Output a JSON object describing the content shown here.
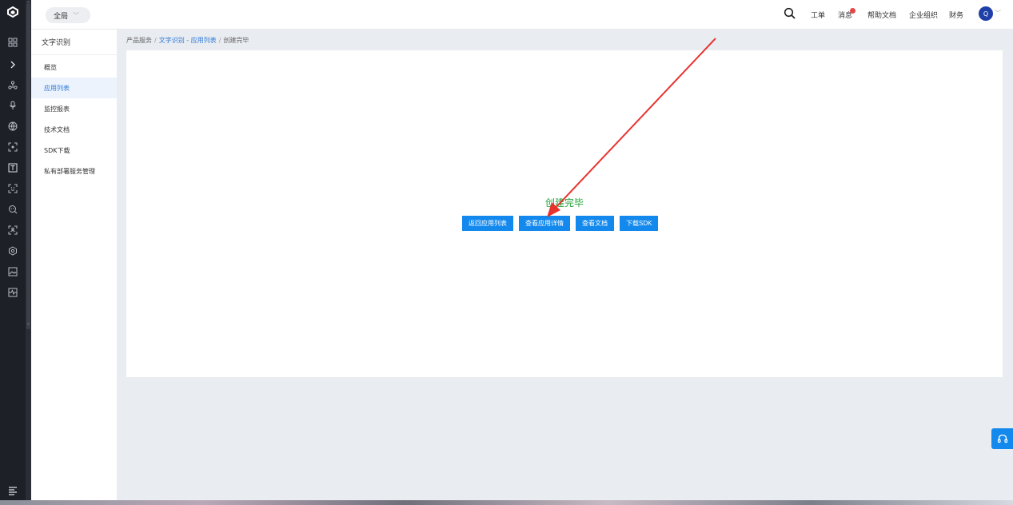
{
  "header": {
    "scope_label": "全局",
    "nav": [
      {
        "key": "ticket",
        "label": "工单"
      },
      {
        "key": "message",
        "label": "消息"
      },
      {
        "key": "help",
        "label": "帮助文档"
      },
      {
        "key": "org",
        "label": "企业组织"
      },
      {
        "key": "finance",
        "label": "财务"
      }
    ],
    "avatar_initial": "Q",
    "message_badge_color": "#e64545"
  },
  "sidebar": {
    "title": "文字识别",
    "items": [
      {
        "label": "概览",
        "active": false
      },
      {
        "label": "应用列表",
        "active": true
      },
      {
        "label": "监控报表",
        "active": false
      },
      {
        "label": "技术文档",
        "active": false
      },
      {
        "label": "SDK下载",
        "active": false
      },
      {
        "label": "私有部署服务管理",
        "active": false
      }
    ]
  },
  "breadcrumb": {
    "root": "产品服务",
    "sep": "/",
    "link": "文字识别 - 应用列表",
    "current": "创建完毕"
  },
  "main": {
    "status_text": "创建完毕",
    "status_color": "#22a33a",
    "buttons": {
      "back": "返回应用列表",
      "detail": "查看应用详情",
      "docs": "查看文档",
      "sdk": "下载SDK"
    }
  },
  "colors": {
    "accent": "#1389ee",
    "link": "#2f7ad8",
    "rail": "#1d2027",
    "annotation_arrow": "#e8322e"
  },
  "icons": {
    "rail": [
      "logo-icon",
      "grid-icon",
      "expand-icon",
      "nodes-icon",
      "mic-icon",
      "globe-icon",
      "scan-icon",
      "text-recognition-icon",
      "face-icon",
      "face-search-icon",
      "face-compare-icon",
      "settings-cube-icon",
      "image-icon",
      "chart-icon",
      "menu-icon"
    ]
  }
}
